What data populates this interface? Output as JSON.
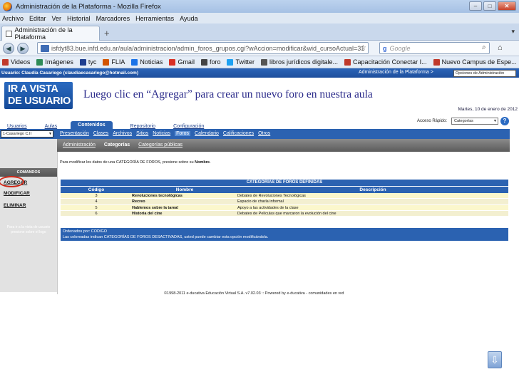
{
  "window": {
    "title": "Administración de la Plataforma - Mozilla Firefox",
    "buttons": {
      "minimize": "–",
      "maximize": "□",
      "close": "✕"
    }
  },
  "menubar": [
    "Archivo",
    "Editar",
    "Ver",
    "Historial",
    "Marcadores",
    "Herramientas",
    "Ayuda"
  ],
  "browser_tab": {
    "label": "Administración de la Plataforma",
    "new_tab": "+"
  },
  "navbar": {
    "back": "◀",
    "forward": "▶",
    "url": "isfdyt83.bue.infd.edu.ar/aula/administracion/admin_foros_grupos.cgi?wAccion=modificar&wid_cursoActual=31",
    "search_placeholder": "Google",
    "search_engine_letter": "g"
  },
  "bookmarks": [
    {
      "label": "Videos",
      "color": "#c0392b"
    },
    {
      "label": "Imágenes",
      "color": "#2e8b57"
    },
    {
      "label": "tyc",
      "color": "#1f3f8f"
    },
    {
      "label": "FLIA",
      "color": "#d35400"
    },
    {
      "label": "Noticias",
      "color": "#1a73e8"
    },
    {
      "label": "Gmail",
      "color": "#d93025"
    },
    {
      "label": "foro",
      "color": "#444444"
    },
    {
      "label": "Twitter",
      "color": "#1da1f2"
    },
    {
      "label": "libros jurídicos digitale...",
      "color": "#555555"
    },
    {
      "label": "Capacitación Conectar I...",
      "color": "#c0392b"
    },
    {
      "label": "Nuevo Campus de Espe...",
      "color": "#c0392b"
    }
  ],
  "page": {
    "user": "Usuario: Claudia Casariego (claudiaecasariego@hotmail.com)",
    "admin_link": "Administración de la Plataforma >",
    "admin_options": "Opciones de Administración",
    "vista_line1": "IR A VISTA",
    "vista_line2": "DE USUARIO",
    "caption": "Luego clic en “Agregar” para crear un nuevo  foro en nuestra aula",
    "date": "Martes, 10 de enero de 2012",
    "quick_access_label": "Acceso Rápido:",
    "quick_access_value": "Categorías",
    "help": "?",
    "main_tabs": [
      "Usuarios",
      "Aulas",
      "Contenidos",
      "Repositorio",
      "Configuración"
    ],
    "course_combo": "1-Casariego C.II",
    "submenu": [
      "Presentación",
      "Clases",
      "Archivos",
      "Sitios",
      "Noticias",
      "Foros",
      "Calendario",
      "Calificaciones",
      "Otros"
    ],
    "submenu2": [
      "Administración",
      "Categorías",
      "Categorías públicas"
    ],
    "commands_title": "COMANDOS",
    "commands": [
      "AGREGAR",
      "MODIFICAR",
      "ELIMINAR"
    ],
    "side_note": "Para ir a la vista de usuario presione sobre el logo",
    "instruction_pre": "Para modificar los datos de una CATEGORÍA DE FOROS, presione sobre su",
    "instruction_bold": "Nombre.",
    "table": {
      "title": "CATEGORÍAS DE FOROS DEFINIDAS",
      "headers": [
        "Código",
        "Nombre",
        "Descripción"
      ],
      "rows": [
        {
          "code": "3",
          "name": "Revoluciones tecnológicas",
          "desc": "Debates de Revoluciones Tecnológicas"
        },
        {
          "code": "4",
          "name": "Recreo",
          "desc": "Espacio de charla informal"
        },
        {
          "code": "5",
          "name": "Hablemos sobre la tarea!",
          "desc": "Apoyo a las actividades de la clase"
        },
        {
          "code": "6",
          "name": "Historia del cine",
          "desc": "Debates de Películas que marcaron la evolución del cine"
        }
      ]
    },
    "ordered_by": "Ordenados por: CODIGO",
    "legend_note": "Las coloreadas indican CATEGORÍAS DE FOROS DESACTIVADAS, usted puede cambiar esta opción modificándola.",
    "footer": "©1998-2011 e-ducativa Educación Virtual S.A. v7.02.03 :: Powered by e-ducativa - comunidades en red"
  },
  "colors": {
    "accent_blue": "#2b62b1",
    "highlight_red": "#d12a1a",
    "row_yellow": "#fbf7cc"
  }
}
